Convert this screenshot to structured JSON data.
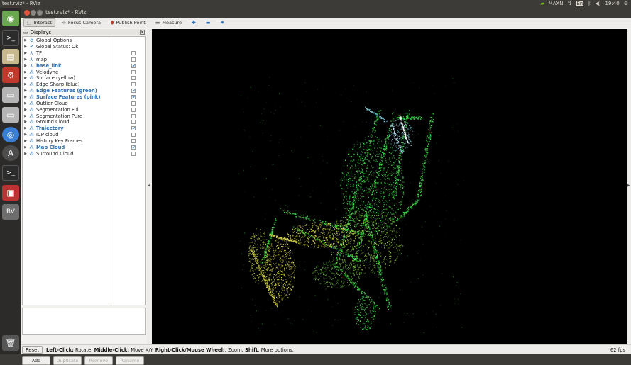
{
  "system": {
    "window_title": "test.rviz* - RViz",
    "tray": {
      "nvidia": "MAXN",
      "keyboard": "En",
      "time": "19:40"
    }
  },
  "window": {
    "title": "test.rviz* - RViz"
  },
  "toolbar": {
    "interact": "Interact",
    "focus_camera": "Focus Camera",
    "publish_point": "Publish Point",
    "measure": "Measure"
  },
  "displays": {
    "title": "Displays",
    "items": [
      {
        "label": "Global Options",
        "icon": "gear-icon",
        "checkbox": false,
        "checked": false,
        "highlight": false
      },
      {
        "label": "Global Status: Ok",
        "icon": "check-icon",
        "checkbox": false,
        "checked": false,
        "highlight": false
      },
      {
        "label": "TF",
        "icon": "tf-icon",
        "checkbox": true,
        "checked": false,
        "highlight": false
      },
      {
        "label": "map",
        "icon": "axes-icon",
        "checkbox": true,
        "checked": false,
        "highlight": false
      },
      {
        "label": "base_link",
        "icon": "axes-icon",
        "checkbox": true,
        "checked": true,
        "highlight": true
      },
      {
        "label": "Velodyne",
        "icon": "pointcloud-icon",
        "checkbox": true,
        "checked": false,
        "highlight": false
      },
      {
        "label": "Surface (yellow)",
        "icon": "pointcloud-icon",
        "checkbox": true,
        "checked": false,
        "highlight": false
      },
      {
        "label": "Edge Sharp (blue)",
        "icon": "pointcloud-icon",
        "checkbox": true,
        "checked": false,
        "highlight": false
      },
      {
        "label": "Edge Features (green)",
        "icon": "pointcloud-icon",
        "checkbox": true,
        "checked": true,
        "highlight": true
      },
      {
        "label": "Surface Features (pink)",
        "icon": "pointcloud-icon",
        "checkbox": true,
        "checked": true,
        "highlight": true
      },
      {
        "label": "Outlier Cloud",
        "icon": "pointcloud-icon",
        "checkbox": true,
        "checked": false,
        "highlight": false
      },
      {
        "label": "Segmentation Full",
        "icon": "pointcloud-icon",
        "checkbox": true,
        "checked": false,
        "highlight": false
      },
      {
        "label": "Segmentation Pure",
        "icon": "pointcloud-icon",
        "checkbox": true,
        "checked": false,
        "highlight": false
      },
      {
        "label": "Ground Cloud",
        "icon": "pointcloud-icon",
        "checkbox": true,
        "checked": false,
        "highlight": false
      },
      {
        "label": "Trajectory",
        "icon": "pointcloud-icon",
        "checkbox": true,
        "checked": true,
        "highlight": true
      },
      {
        "label": "ICP cloud",
        "icon": "pointcloud-icon",
        "checkbox": true,
        "checked": false,
        "highlight": false
      },
      {
        "label": "History Key Frames",
        "icon": "pointcloud-icon",
        "checkbox": true,
        "checked": false,
        "highlight": false
      },
      {
        "label": "Map Cloud",
        "icon": "pointcloud-icon",
        "checkbox": true,
        "checked": true,
        "highlight": true
      },
      {
        "label": "Surround Cloud",
        "icon": "pointcloud-icon",
        "checkbox": true,
        "checked": false,
        "highlight": false
      }
    ],
    "buttons": {
      "add": "Add",
      "duplicate": "Duplicate",
      "remove": "Remove",
      "rename": "Rename"
    }
  },
  "status": {
    "reset": "Reset",
    "help_parts": [
      {
        "t": "Left-Click:",
        "b": true
      },
      {
        "t": " Rotate. ",
        "b": false
      },
      {
        "t": "Middle-Click:",
        "b": true
      },
      {
        "t": " Move X/Y. ",
        "b": false
      },
      {
        "t": "Right-Click/Mouse Wheel:",
        "b": true
      },
      {
        "t": ": Zoom. ",
        "b": false
      },
      {
        "t": "Shift",
        "b": true
      },
      {
        "t": ": More options.",
        "b": false
      }
    ],
    "fps": "62 fps"
  },
  "colors": {
    "highlight_text": "#2a6db3",
    "point_green": "#3fe04a",
    "point_yellow": "#d8d64a",
    "point_cyan": "#7fd0e0"
  }
}
